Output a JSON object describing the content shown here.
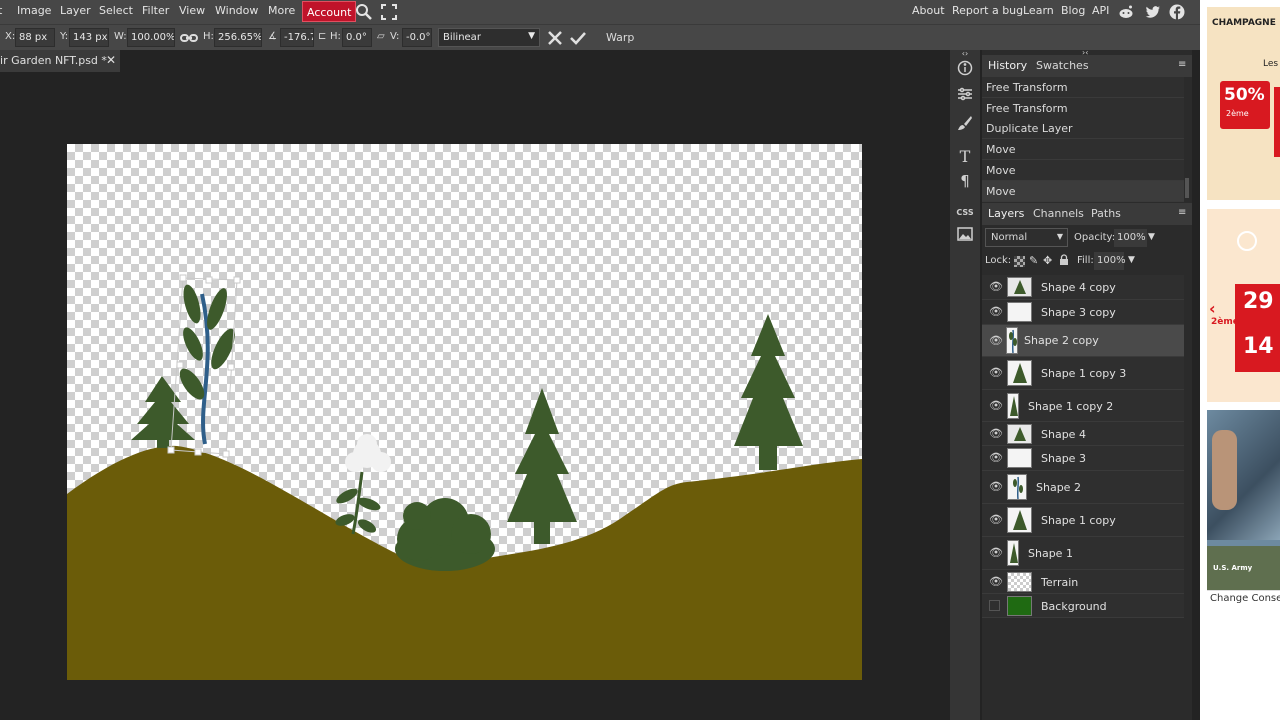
{
  "menu": {
    "items": [
      "Image",
      "Layer",
      "Select",
      "Filter",
      "View",
      "Window",
      "More"
    ],
    "account": "Account",
    "right_links": [
      "About",
      "Report a bug",
      "Learn",
      "Blog",
      "API"
    ]
  },
  "options": {
    "x_label": "X:",
    "x_value": "88 px",
    "y_label": "Y:",
    "y_value": "143 px",
    "w_label": "W:",
    "w_value": "100.00%",
    "h_label": "H:",
    "h_value": "256.65%",
    "angle_value": "-176.7",
    "skew_h_label": "H:",
    "skew_h_value": "0.0°",
    "skew_v_label": "V:",
    "skew_v_value": "-0.0°",
    "interpolation": "Bilinear",
    "warp_label": "Warp"
  },
  "document": {
    "tab_title": "Fair Garden NFT.psd *"
  },
  "history": {
    "tabs": [
      "History",
      "Swatches"
    ],
    "entries": [
      "Free Transform",
      "Free Transform",
      "Duplicate Layer",
      "Move",
      "Move",
      "Move"
    ]
  },
  "layers": {
    "tabs": [
      "Layers",
      "Channels",
      "Paths"
    ],
    "blend_mode": "Normal",
    "opacity_label": "Opacity:",
    "opacity_value": "100%",
    "lock_label": "Lock:",
    "fill_label": "Fill:",
    "fill_value": "100%",
    "items": [
      {
        "name": "Shape 4 copy"
      },
      {
        "name": "Shape 3 copy"
      },
      {
        "name": "Shape 2 copy"
      },
      {
        "name": "Shape 1 copy 3"
      },
      {
        "name": "Shape 1 copy 2"
      },
      {
        "name": "Shape 4"
      },
      {
        "name": "Shape 3"
      },
      {
        "name": "Shape 2"
      },
      {
        "name": "Shape 1 copy"
      },
      {
        "name": "Shape 1"
      },
      {
        "name": "Terrain"
      },
      {
        "name": "Background"
      }
    ],
    "selected": "Shape 2 copy"
  },
  "ads": {
    "ad1_text": "CHAMPAGNE",
    "ad1_line2": "Les",
    "ad1_percent": "50%",
    "ad1_sub": "2ème",
    "ad2_price": "29",
    "ad2_price2": "14",
    "ad2_sub": "2ème",
    "ad3_brand": "U.S. Army",
    "consent": "Change Consent"
  },
  "colors": {
    "accent": "#c0132a",
    "terrain": "#6b5c09",
    "foliage": "#3d5a2b",
    "stem": "#2f5f8a",
    "background_layer": "#1f6a12"
  }
}
